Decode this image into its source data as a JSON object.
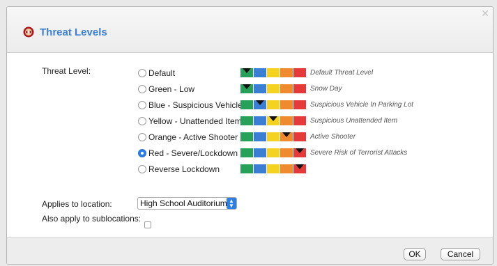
{
  "dialog": {
    "title": "Threat Levels",
    "close_glyph": "✕"
  },
  "form": {
    "threat_level_label": "Threat Level:",
    "applies_label": "Applies to location:",
    "sublocations_label": "Also apply to sublocations:",
    "location_value": "High School Auditorium",
    "sublocations_checked": false
  },
  "palette": {
    "green": "#27a05a",
    "blue": "#3b7fd4",
    "yellow": "#f5d21f",
    "orange": "#f08a2e",
    "red": "#e63a3a"
  },
  "options": [
    {
      "label": "Default",
      "desc": "Default Threat Level",
      "selected": false,
      "marker": 0
    },
    {
      "label": "Green - Low",
      "desc": "Snow Day",
      "selected": false,
      "marker": 0
    },
    {
      "label": "Blue - Suspicious Vehicle",
      "desc": "Suspicious Vehicle In Parking Lot",
      "selected": false,
      "marker": 1
    },
    {
      "label": "Yellow - Unattended Item",
      "desc": "Suspicious Unattended Item",
      "selected": false,
      "marker": 2
    },
    {
      "label": "Orange - Active Shooter",
      "desc": "Active Shooter",
      "selected": false,
      "marker": 3
    },
    {
      "label": "Red - Severe/Lockdown",
      "desc": "Severe Risk of Terrorist Attacks",
      "selected": true,
      "marker": 4
    },
    {
      "label": "Reverse Lockdown",
      "desc": "",
      "selected": false,
      "marker": 4
    }
  ],
  "buttons": {
    "ok": "OK",
    "cancel": "Cancel"
  },
  "icons": {
    "title": "threat-level-icon",
    "close": "close-icon",
    "select": "up-down-chevron-icon"
  }
}
